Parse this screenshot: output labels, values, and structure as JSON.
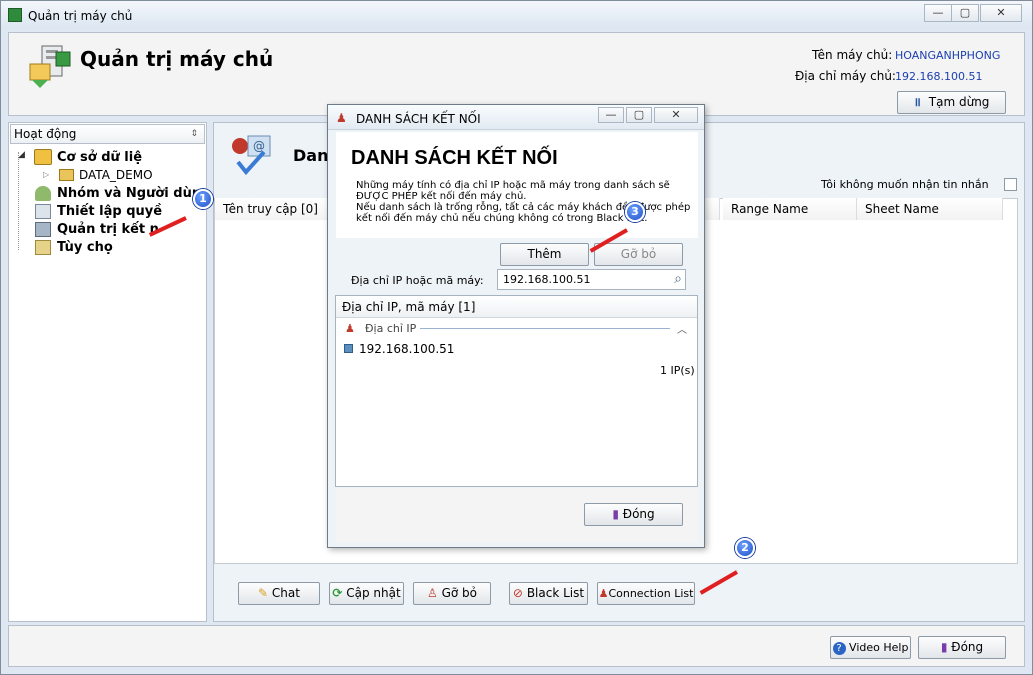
{
  "window": {
    "title": "Quản trị máy chủ",
    "minimize": "—",
    "maximize": "▢",
    "close": "✕"
  },
  "header": {
    "title": "Quản trị máy chủ",
    "server_name_label": "Tên máy chủ:",
    "server_name_value": "HOANGANHPHONG",
    "server_address_label": "Địa chỉ máy chủ:",
    "server_address_value": "192.168.100.51",
    "pause_button": "Tạm dừng"
  },
  "sidebar": {
    "dropdown_label": "Hoạt động",
    "items": [
      {
        "label": "Cơ sở dữ liệ"
      },
      {
        "label": "DATA_DEMO"
      },
      {
        "label": "Nhóm và Người dùn"
      },
      {
        "label": "Thiết lập quyề"
      },
      {
        "label": "Quản trị kết n"
      },
      {
        "label": "Tùy chọ"
      }
    ]
  },
  "main": {
    "title": "Danh",
    "no_message_label": "Tôi không muốn nhận tin nhắn",
    "columns": [
      "Tên truy cập [0]",
      "Range Name",
      "Sheet Name"
    ],
    "buttons": {
      "chat": "Chat",
      "update": "Cập nhật",
      "remove": "Gỡ bỏ",
      "black_list": "Black List",
      "connection_list": "Connection List"
    }
  },
  "footer": {
    "video_help": "Video Help",
    "close": "Đóng"
  },
  "dialog": {
    "title": "DANH SÁCH KẾT NỐI",
    "heading": "DANH SÁCH KẾT NỐI",
    "desc_lines": [
      "Những máy tính có địa chỉ IP hoặc mã máy trong danh sách sẽ",
      "ĐƯỢC PHÉP kết nối đến máy chủ.",
      "Nếu danh sách là trống rỗng, tất cả các máy khách đều được phép",
      "kết nối đến máy chủ nếu chúng không có trong Black List."
    ],
    "add_button": "Thêm",
    "remove_button": "Gỡ bỏ",
    "ip_label": "Địa chỉ IP hoặc mã máy:",
    "ip_value": "192.168.100.51",
    "list_header": "Địa chỉ IP, mã máy [1]",
    "group_label": "Địa chỉ IP",
    "entries": [
      "192.168.100.51"
    ],
    "count_label": "1 IP(s)",
    "close_button": "Đóng"
  },
  "annotations": [
    "1",
    "2",
    "3"
  ]
}
